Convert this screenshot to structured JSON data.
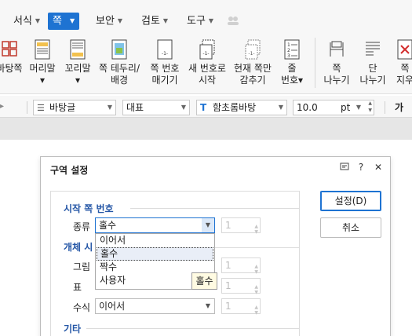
{
  "menubar": {
    "items": [
      {
        "label": "서식",
        "active": false
      },
      {
        "label": "쪽",
        "active": true
      },
      {
        "label": "보안",
        "active": false
      },
      {
        "label": "검토",
        "active": false
      },
      {
        "label": "도구",
        "active": false
      }
    ]
  },
  "ribbon": {
    "buttons": [
      {
        "label": "바탕쪽",
        "icon": "master-page-icon"
      },
      {
        "label": "머리말",
        "sub": "▾",
        "icon": "header-icon"
      },
      {
        "label": "꼬리말",
        "sub": "▾",
        "icon": "footer-icon"
      },
      {
        "label": "쪽 테두리/\n배경",
        "icon": "page-border-icon"
      },
      {
        "label": "쪽 번호\n매기기",
        "icon": "page-number-icon"
      },
      {
        "label": "새 번호로\n시작",
        "icon": "new-number-icon"
      },
      {
        "label": "현재 쪽만\n감추기",
        "icon": "hide-page-icon"
      },
      {
        "label": "줄\n번호▾",
        "icon": "line-number-icon"
      },
      {
        "label": "쪽\n나누기",
        "icon": "page-break-icon"
      },
      {
        "label": "단\n나누기",
        "icon": "column-break-icon"
      },
      {
        "label": "쪽\n지우",
        "icon": "delete-page-icon"
      }
    ]
  },
  "formatbar": {
    "style_value": "바탕글",
    "lang_value": "대표",
    "font_value": "함초롬바탕",
    "size_value": "10.0",
    "unit_value": "pt",
    "bold_label": "가"
  },
  "dialog": {
    "title": "구역 설정",
    "help_label": "?",
    "close_label": "✕",
    "section_start": "시작 쪽 번호",
    "kind_label": "종류",
    "kind_value": "홀수",
    "kind_spin": "1",
    "section_objects": "개체 시작 번호",
    "section_objects_visible": "개체 시",
    "picture_label": "그림",
    "picture_spin": "1",
    "table_label": "표",
    "table_spin": "1",
    "equation_label": "수식",
    "equation_value": "이어서",
    "equation_spin": "1",
    "section_other": "기타",
    "ok_button": "설정(D)",
    "cancel_button": "취소",
    "dropdown_options": [
      "이어서",
      "홀수",
      "짝수",
      "사용자"
    ],
    "dropdown_selected": "홀수",
    "tooltip": "홀수"
  },
  "colors": {
    "accent": "#1e73d2",
    "section_title": "#2456a6",
    "tooltip_bg": "#fffbe2"
  }
}
